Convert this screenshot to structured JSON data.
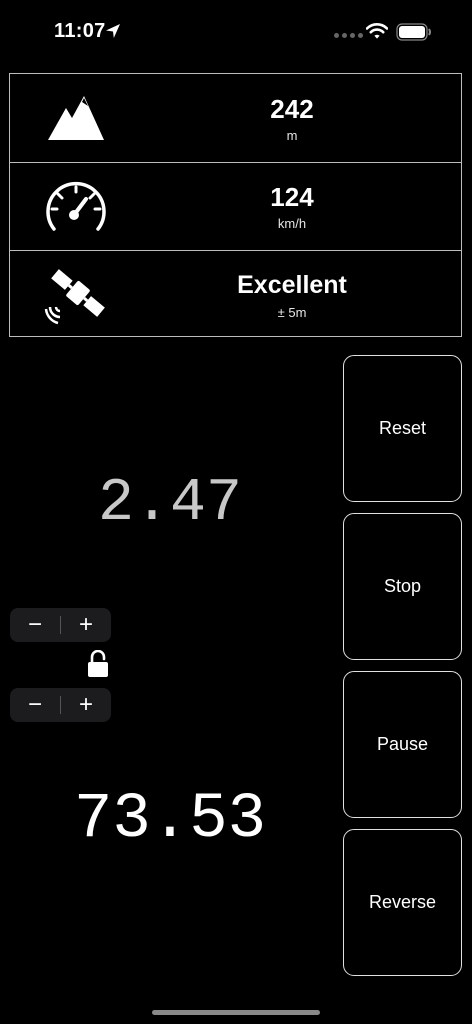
{
  "status_bar": {
    "time": "11:07"
  },
  "info": {
    "altitude": {
      "icon": "mountain-icon",
      "value": "242",
      "unit": "m"
    },
    "speed": {
      "icon": "speedometer-icon",
      "value": "124",
      "unit": "km/h"
    },
    "gps": {
      "icon": "satellite-icon",
      "value": "Excellent",
      "accuracy": "± 5m"
    }
  },
  "readouts": {
    "top": "2.47",
    "bottom": "73.53"
  },
  "steppers": {
    "minus": "−",
    "plus": "+"
  },
  "actions": {
    "reset": "Reset",
    "stop": "Stop",
    "pause": "Pause",
    "reverse": "Reverse"
  }
}
